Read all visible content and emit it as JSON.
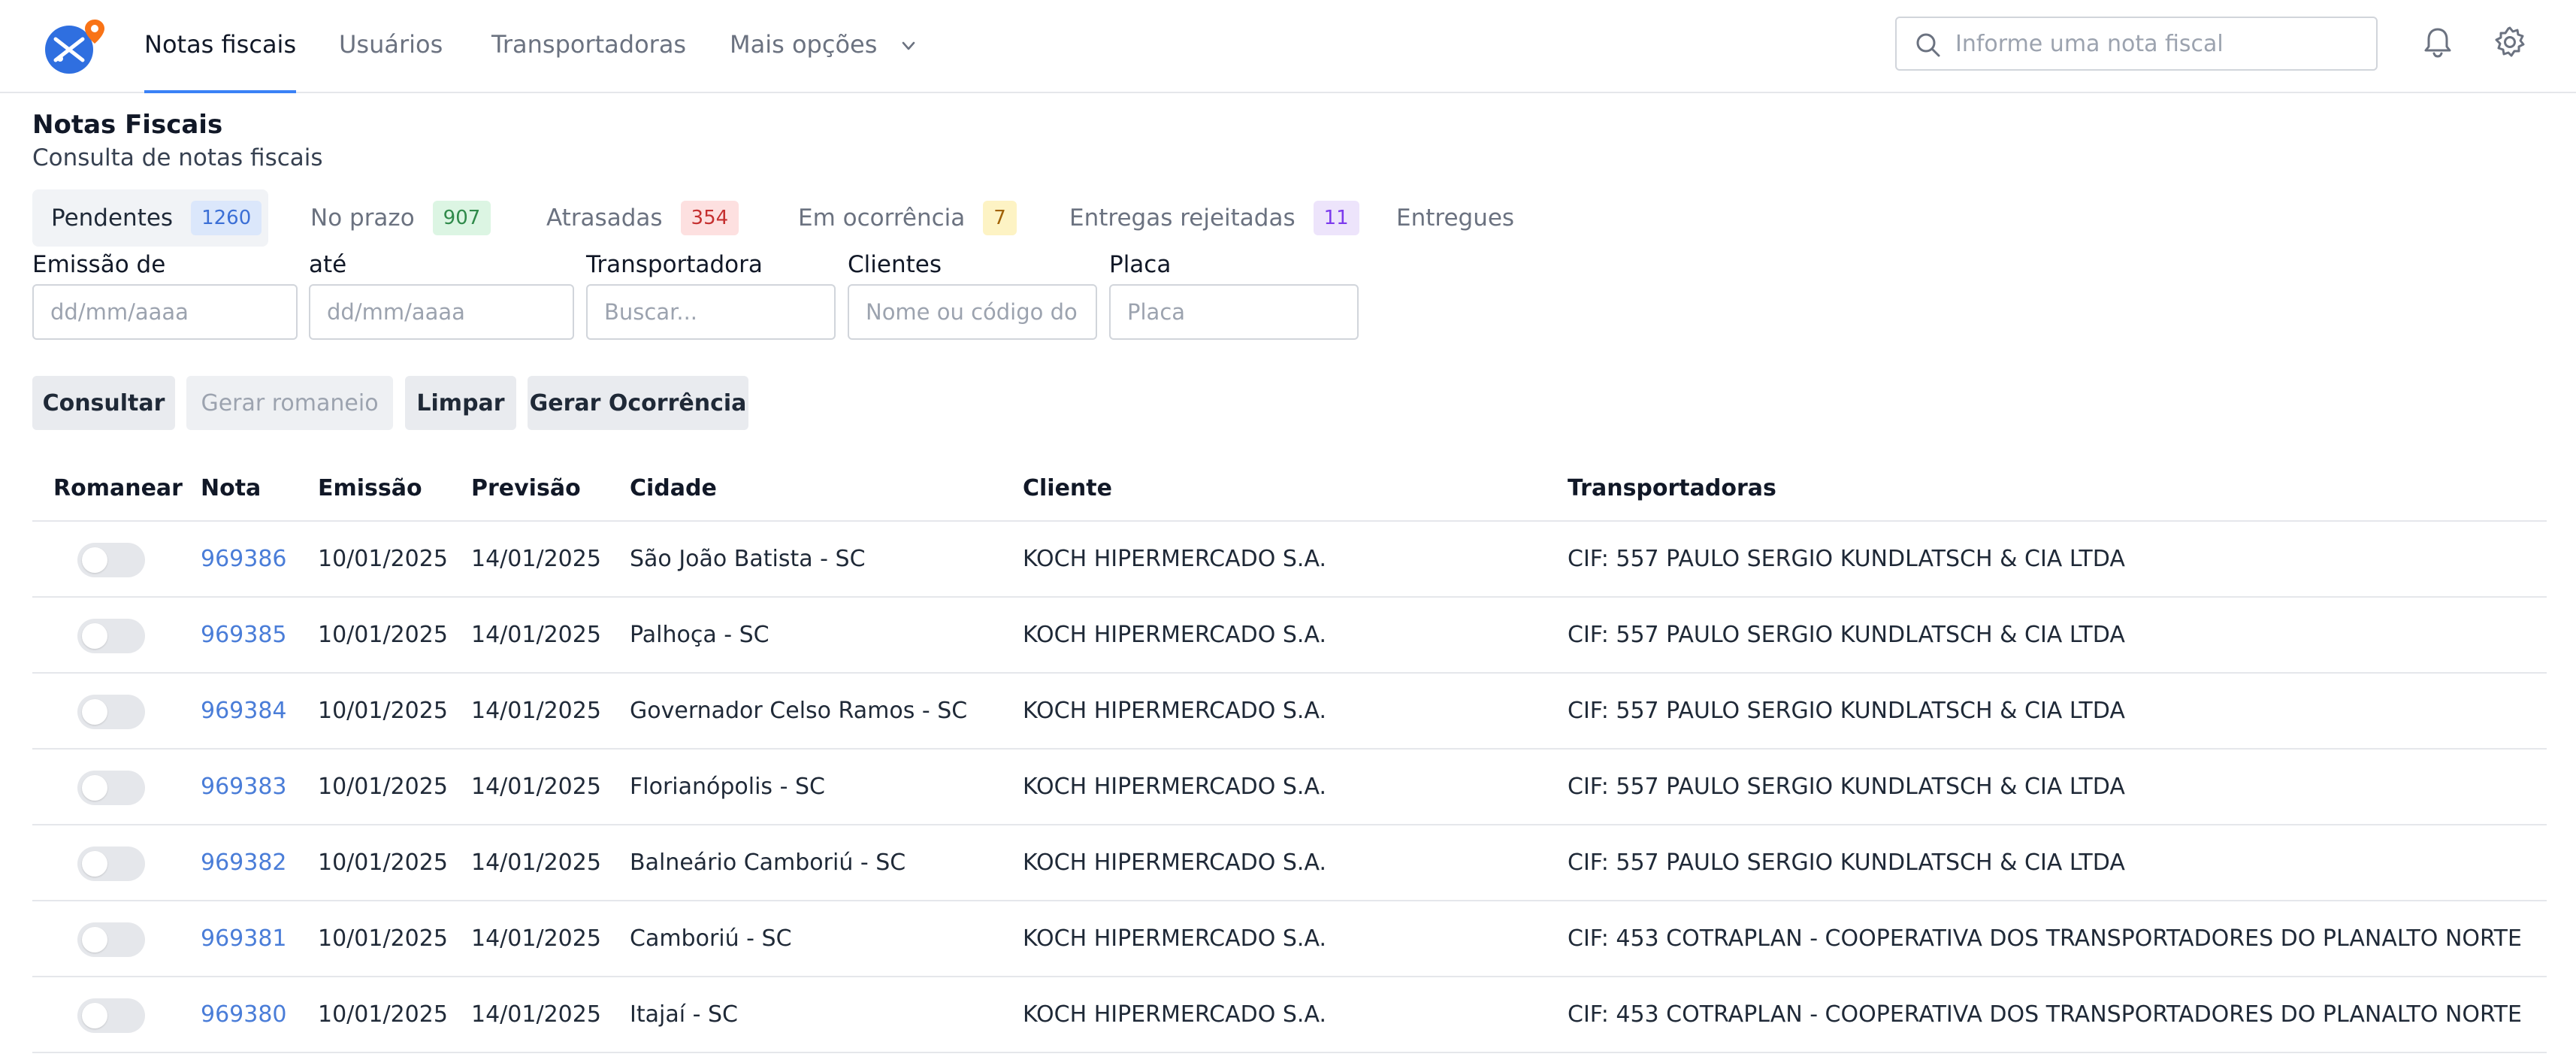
{
  "nav": {
    "items": [
      {
        "label": "Notas fiscais",
        "active": true
      },
      {
        "label": "Usuários",
        "active": false
      },
      {
        "label": "Transportadoras",
        "active": false
      },
      {
        "label": "Mais opções",
        "active": false
      }
    ],
    "search_placeholder": "Informe uma nota fiscal",
    "icons": [
      "logo",
      "search-icon",
      "bell-icon",
      "gear-icon",
      "chevron-down-icon"
    ]
  },
  "page": {
    "title": "Notas Fiscais",
    "subtitle": "Consulta de notas fiscais"
  },
  "status_tabs": [
    {
      "label": "Pendentes",
      "count": "1260",
      "active": true,
      "badge_bg": "#dbe7fb",
      "badge_fg": "#3b6fd6"
    },
    {
      "label": "No prazo",
      "count": "907",
      "active": false,
      "badge_bg": "#dcf5e3",
      "badge_fg": "#2f8a4a"
    },
    {
      "label": "Atrasadas",
      "count": "354",
      "active": false,
      "badge_bg": "#fde0e0",
      "badge_fg": "#c53030"
    },
    {
      "label": "Em ocorrência",
      "count": "7",
      "active": false,
      "badge_bg": "#fdf3c4",
      "badge_fg": "#a16207"
    },
    {
      "label": "Entregas rejeitadas",
      "count": "11",
      "active": false,
      "badge_bg": "#ede4fb",
      "badge_fg": "#7c3aed"
    },
    {
      "label": "Entregues",
      "count": "",
      "active": false,
      "badge_bg": "",
      "badge_fg": ""
    }
  ],
  "filters": {
    "emissao_de": {
      "label": "Emissão de",
      "placeholder": "dd/mm/aaaa"
    },
    "ate": {
      "label": "até",
      "placeholder": "dd/mm/aaaa"
    },
    "transportadora": {
      "label": "Transportadora",
      "placeholder": "Buscar..."
    },
    "clientes": {
      "label": "Clientes",
      "placeholder": "Nome ou código do"
    },
    "placa": {
      "label": "Placa",
      "placeholder": "Placa"
    }
  },
  "actions": {
    "consultar": "Consultar",
    "gerar_romaneio": "Gerar romaneio",
    "limpar": "Limpar",
    "gerar_ocorrencia": "Gerar Ocorrência"
  },
  "table": {
    "headers": {
      "romanear": "Romanear",
      "nota": "Nota",
      "emissao": "Emissão",
      "previsao": "Previsão",
      "cidade": "Cidade",
      "cliente": "Cliente",
      "transportadoras": "Transportadoras"
    },
    "rows": [
      {
        "nota": "969386",
        "emissao": "10/01/2025",
        "previsao": "14/01/2025",
        "cidade": "São João Batista - SC",
        "cliente": "KOCH HIPERMERCADO S.A.",
        "transportadora": "CIF: 557 PAULO SERGIO KUNDLATSCH & CIA LTDA",
        "romanear": false
      },
      {
        "nota": "969385",
        "emissao": "10/01/2025",
        "previsao": "14/01/2025",
        "cidade": "Palhoça - SC",
        "cliente": "KOCH HIPERMERCADO S.A.",
        "transportadora": "CIF: 557 PAULO SERGIO KUNDLATSCH & CIA LTDA",
        "romanear": false
      },
      {
        "nota": "969384",
        "emissao": "10/01/2025",
        "previsao": "14/01/2025",
        "cidade": "Governador Celso Ramos - SC",
        "cliente": "KOCH HIPERMERCADO S.A.",
        "transportadora": "CIF: 557 PAULO SERGIO KUNDLATSCH & CIA LTDA",
        "romanear": false
      },
      {
        "nota": "969383",
        "emissao": "10/01/2025",
        "previsao": "14/01/2025",
        "cidade": "Florianópolis - SC",
        "cliente": "KOCH HIPERMERCADO S.A.",
        "transportadora": "CIF: 557 PAULO SERGIO KUNDLATSCH & CIA LTDA",
        "romanear": false
      },
      {
        "nota": "969382",
        "emissao": "10/01/2025",
        "previsao": "14/01/2025",
        "cidade": "Balneário Camboriú - SC",
        "cliente": "KOCH HIPERMERCADO S.A.",
        "transportadora": "CIF: 557 PAULO SERGIO KUNDLATSCH & CIA LTDA",
        "romanear": false
      },
      {
        "nota": "969381",
        "emissao": "10/01/2025",
        "previsao": "14/01/2025",
        "cidade": "Camboriú - SC",
        "cliente": "KOCH HIPERMERCADO S.A.",
        "transportadora": "CIF: 453 COTRAPLAN - COOPERATIVA DOS TRANSPORTADORES DO PLANALTO NORTE",
        "romanear": false
      },
      {
        "nota": "969380",
        "emissao": "10/01/2025",
        "previsao": "14/01/2025",
        "cidade": "Itajaí - SC",
        "cliente": "KOCH HIPERMERCADO S.A.",
        "transportadora": "CIF: 453 COTRAPLAN - COOPERATIVA DOS TRANSPORTADORES DO PLANALTO NORTE",
        "romanear": false
      }
    ]
  },
  "colors": {
    "accent": "#3b82f6",
    "link": "#4a7dd8",
    "logo_blue": "#2f6fe0",
    "logo_pin": "#f97316"
  }
}
